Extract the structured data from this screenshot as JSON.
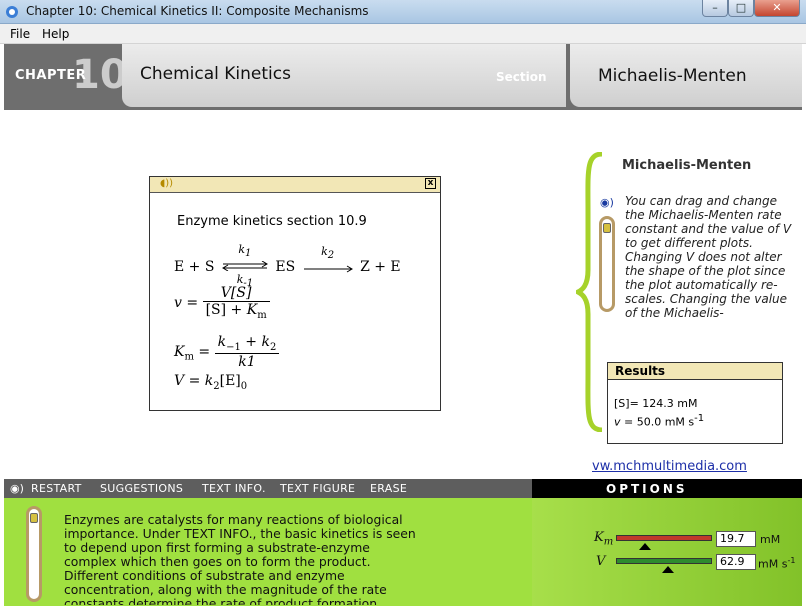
{
  "window": {
    "title": "Chapter 10: Chemical Kinetics II: Composite Mechanisms",
    "min": "–",
    "max": "□",
    "close": "✕"
  },
  "menu": [
    "File",
    "Help"
  ],
  "header": {
    "chapter_label": "CHAPTER",
    "chapter_number": "10",
    "title": "Chemical Kinetics",
    "section_label": "Section",
    "topic": "Michaelis-Menten"
  },
  "equations": {
    "heading": "Enzyme kinetics section 10.9",
    "close": "x",
    "eq1": {
      "left": "E + S",
      "k1": "k",
      "k1sub": "1",
      "km1": "k",
      "km1sub": "-1",
      "mid": "ES",
      "k2": "k",
      "k2sub": "2",
      "right": "Z + E"
    },
    "eq2": {
      "lhs": "v",
      "num": "V[S]",
      "den_a": "[S] + ",
      "den_b": "K",
      "den_sub": "m"
    },
    "eq3": {
      "lhs": "K",
      "lhs_sub": "m",
      "num": "k",
      "num_sub1": "−1",
      "num_plus": " + k",
      "num_sub2": "2",
      "den": "k1"
    },
    "eq4": {
      "lhs": "V",
      "rhs": "k",
      "rhs_sub": "2",
      "rhs_tail": "[E]",
      "tail_sub": "0"
    }
  },
  "side": {
    "title": "Michaelis-Menten",
    "text": "You can drag and change the Michaelis-Menten rate constant and the value of V to get different plots. Changing V does not alter the shape of the plot since the plot automatically re-scales.  Changing the value of the Michaelis-"
  },
  "results": {
    "title": "Results",
    "s_label": "[S]= 124.3 mM",
    "v_label": "v",
    "v_value": " = 50.0 mM s",
    "v_sup": "-1"
  },
  "link": "vw.mchmultimedia.com",
  "toolbar": {
    "items": [
      "RESTART",
      "SUGGESTIONS",
      "TEXT INFO.",
      "TEXT FIGURE",
      "ERASE"
    ],
    "options": "OPTIONS"
  },
  "bottom_text": "Enzymes are catalysts for many reactions of biological importance.  Under TEXT INFO., the basic kinetics is seen to depend upon first forming a substrate-enzyme complex which then goes on to form the product. Different conditions of substrate and enzyme concentration, along with the magnitude of the rate constants determine the rate of product formation.",
  "controls": {
    "km": {
      "label": "K",
      "sub": "m",
      "value": "19.7",
      "unit": "mM",
      "level": 0.3
    },
    "v": {
      "label": "V",
      "value": "62.9",
      "unit": "mM s",
      "unit_sup": "-1",
      "level": 0.54
    }
  },
  "colors": {
    "header": "#6e6e6e",
    "panel_bar": "#f2e7b6",
    "green": "#a0e040",
    "km_track": "#c0392b",
    "v_track": "#2e8b2e"
  }
}
